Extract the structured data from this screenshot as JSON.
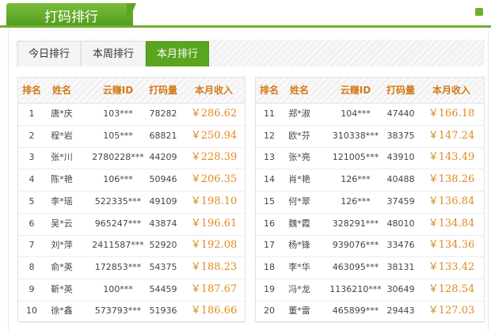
{
  "header": {
    "title": "打码排行"
  },
  "tabs": [
    {
      "label": "今日排行",
      "active": false
    },
    {
      "label": "本周排行",
      "active": false
    },
    {
      "label": "本月排行",
      "active": true
    }
  ],
  "columns": [
    "排名",
    "姓名",
    "云赚ID",
    "打码量",
    "本月收入"
  ],
  "left_table": [
    {
      "rank": "1",
      "name": "唐*庆",
      "id": "103***",
      "count": "78282",
      "income": "￥286.62"
    },
    {
      "rank": "2",
      "name": "程*岩",
      "id": "105***",
      "count": "68821",
      "income": "￥250.94"
    },
    {
      "rank": "3",
      "name": "张*川",
      "id": "2780228***",
      "count": "44209",
      "income": "￥228.39"
    },
    {
      "rank": "4",
      "name": "陈*艳",
      "id": "106***",
      "count": "50946",
      "income": "￥206.35"
    },
    {
      "rank": "5",
      "name": "李*瑶",
      "id": "522335***",
      "count": "49109",
      "income": "￥198.10"
    },
    {
      "rank": "6",
      "name": "吴*云",
      "id": "965247***",
      "count": "43874",
      "income": "￥196.61"
    },
    {
      "rank": "7",
      "name": "刘*萍",
      "id": "2411587***",
      "count": "52920",
      "income": "￥192.08"
    },
    {
      "rank": "8",
      "name": "俞*英",
      "id": "172853***",
      "count": "54375",
      "income": "￥188.23"
    },
    {
      "rank": "9",
      "name": "靳*英",
      "id": "100***",
      "count": "54459",
      "income": "￥187.67"
    },
    {
      "rank": "10",
      "name": "徐*鑫",
      "id": "573793***",
      "count": "51936",
      "income": "￥186.66"
    }
  ],
  "right_table": [
    {
      "rank": "11",
      "name": "郑*淑",
      "id": "104***",
      "count": "47440",
      "income": "￥166.18"
    },
    {
      "rank": "12",
      "name": "欧*芬",
      "id": "310338***",
      "count": "38375",
      "income": "￥147.24"
    },
    {
      "rank": "13",
      "name": "张*亮",
      "id": "121005***",
      "count": "43910",
      "income": "￥143.49"
    },
    {
      "rank": "14",
      "name": "肖*艳",
      "id": "126***",
      "count": "40488",
      "income": "￥138.26"
    },
    {
      "rank": "15",
      "name": "何*翠",
      "id": "126***",
      "count": "37459",
      "income": "￥136.84"
    },
    {
      "rank": "16",
      "name": "魏*霞",
      "id": "328291***",
      "count": "48010",
      "income": "￥134.84"
    },
    {
      "rank": "17",
      "name": "杨*锋",
      "id": "939076***",
      "count": "33476",
      "income": "￥134.36"
    },
    {
      "rank": "18",
      "name": "李*华",
      "id": "463095***",
      "count": "38131",
      "income": "￥133.42"
    },
    {
      "rank": "19",
      "name": "冯*龙",
      "id": "1136210***",
      "count": "30649",
      "income": "￥128.54"
    },
    {
      "rank": "20",
      "name": "董*雷",
      "id": "465899***",
      "count": "29443",
      "income": "￥127.03"
    }
  ],
  "colors": {
    "accent_green": "#5aa520",
    "income_orange": "#e08a20",
    "header_orange": "#d27a1a"
  }
}
